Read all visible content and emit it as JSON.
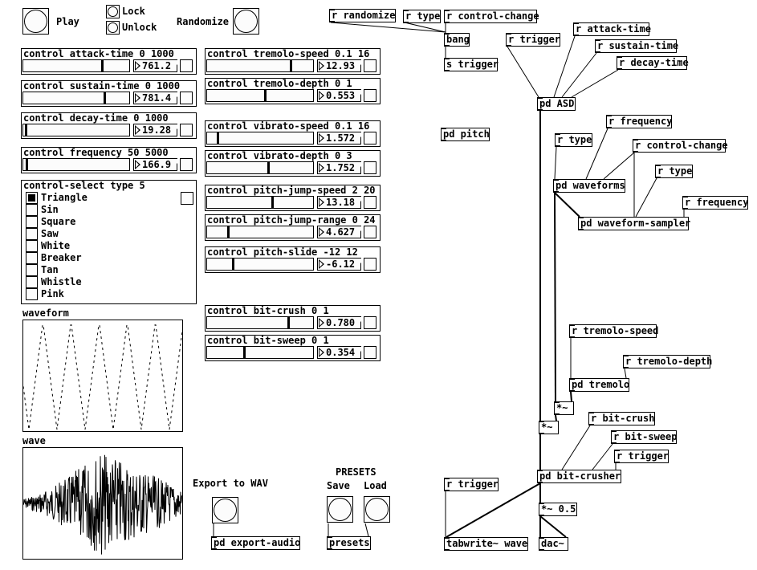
{
  "top": {
    "play_label": "Play",
    "lock_label": "Lock",
    "unlock_label": "Unlock",
    "randomize_label": "Randomize"
  },
  "controls_left": [
    {
      "label": "control attack-time 0 1000",
      "value": "761.2",
      "min": 0,
      "max": 1000
    },
    {
      "label": "control sustain-time 0 1000",
      "value": "781.4",
      "min": 0,
      "max": 1000
    },
    {
      "label": "control decay-time 0 1000",
      "value": "19.28",
      "min": 0,
      "max": 1000
    },
    {
      "label": "control frequency 50 5000",
      "value": "166.9",
      "min": 50,
      "max": 5000
    }
  ],
  "controls_right": [
    {
      "label": "control tremolo-speed 0.1 16",
      "value": "12.93",
      "min": 0.1,
      "max": 16
    },
    {
      "label": "control tremolo-depth 0 1",
      "value": "0.553",
      "min": 0,
      "max": 1
    },
    {
      "label": "control vibrato-speed 0.1 16",
      "value": "1.572",
      "min": 0.1,
      "max": 16
    },
    {
      "label": "control vibrato-depth 0 3",
      "value": "1.752",
      "min": 0,
      "max": 3
    },
    {
      "label": "control pitch-jump-speed 2 20",
      "value": "13.18",
      "min": 2,
      "max": 20
    },
    {
      "label": "control pitch-jump-range 0 24",
      "value": "4.627",
      "min": 0,
      "max": 24
    },
    {
      "label": "control pitch-slide -12 12",
      "value": "-6.12",
      "min": -12,
      "max": 12
    },
    {
      "label": "control bit-crush 0 1",
      "value": "0.780",
      "min": 0,
      "max": 1
    },
    {
      "label": "control bit-sweep 0 1",
      "value": "0.354",
      "min": 0,
      "max": 1
    }
  ],
  "select": {
    "label": "control-select type 5",
    "selected_index": 0,
    "options": [
      "Triangle",
      "Sin",
      "Square",
      "Saw",
      "White",
      "Breaker",
      "Tan",
      "Whistle",
      "Pink"
    ]
  },
  "waveform_graph": {
    "label": "waveform",
    "shape": "triangle"
  },
  "wave_graph": {
    "label": "wave"
  },
  "export": {
    "label": "Export to WAV",
    "object": "pd export-audio"
  },
  "presets": {
    "title": "PRESETS",
    "save_label": "Save",
    "load_label": "Load",
    "object": "presets"
  },
  "objects": [
    "r randomize",
    "r type",
    "r control-change",
    "bang",
    "s trigger",
    "r trigger",
    "r attack-time",
    "r sustain-time",
    "r decay-time",
    "pd ASD",
    "pd pitch",
    "r frequency",
    "r type",
    "r control-change",
    "r type",
    "pd waveforms",
    "r frequency",
    "pd waveform-sampler",
    "r tremolo-speed",
    "r tremolo-depth",
    "pd tremolo",
    "*~",
    "*~",
    "r bit-crush",
    "r bit-sweep",
    "r trigger",
    "pd bit-crusher",
    "*~ 0.5",
    "dac~",
    "r trigger",
    "tabwrite~ wave"
  ]
}
